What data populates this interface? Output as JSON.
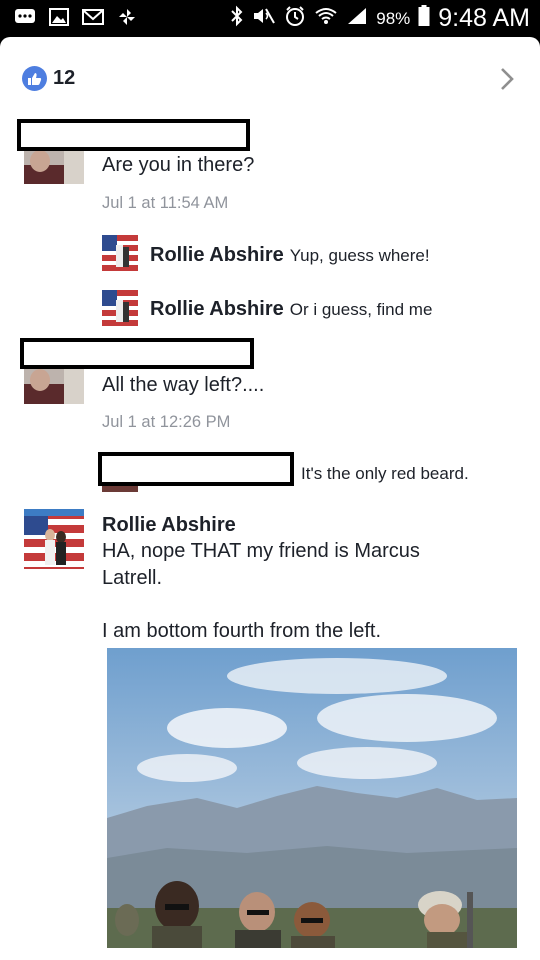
{
  "status_bar": {
    "battery": "98%",
    "time": "9:48 AM"
  },
  "post": {
    "like_count": "12"
  },
  "comments": [
    {
      "text": "Are you in there?",
      "time": "Jul 1 at 11:54 AM",
      "replies": [
        {
          "name": "Rollie Abshire",
          "text": "Yup, guess where!"
        },
        {
          "name": "Rollie Abshire",
          "text": "Or i guess, find me"
        }
      ]
    },
    {
      "text": "All the way left?....",
      "time": "Jul 1 at 12:26 PM",
      "replies": [
        {
          "text": "It's the only red beard."
        }
      ]
    },
    {
      "name": "Rollie Abshire",
      "lines": [
        "HA, nope THAT my friend is Marcus",
        "Latrell.",
        "I am bottom fourth from the left."
      ]
    }
  ],
  "colors": {
    "like_blue": "#4e7ee0",
    "text": "#1d2129",
    "meta": "#90949c"
  }
}
